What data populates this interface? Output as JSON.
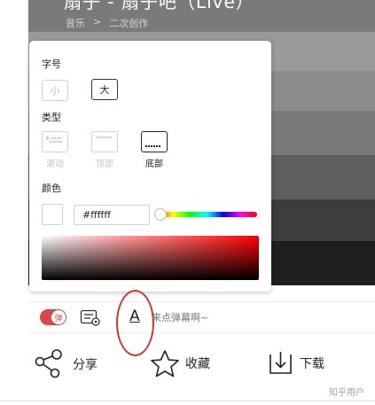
{
  "video": {
    "title": "扇子 - 扇子吧（Live）",
    "breadcrumb": [
      "音乐",
      ">",
      "二次创作"
    ]
  },
  "danmaku_settings": {
    "font_size": {
      "label": "字号",
      "options": [
        {
          "label": "小",
          "selected": false
        },
        {
          "label": "大",
          "selected": true
        }
      ]
    },
    "type": {
      "label": "类型",
      "options": [
        {
          "label": "滚动",
          "icon": "scroll-danmaku-icon",
          "selected": false
        },
        {
          "label": "顶部",
          "icon": "top-danmaku-icon",
          "selected": false
        },
        {
          "label": "底部",
          "icon": "bottom-danmaku-icon",
          "selected": true
        }
      ]
    },
    "color": {
      "label": "颜色",
      "value": "#ffffff",
      "hue_position": 0.0
    }
  },
  "toolbar": {
    "danmaku_toggle_label": "弹",
    "danmaku_enabled": true,
    "input_placeholder": "来点弹幕啊~"
  },
  "actions": [
    {
      "label": "分享",
      "icon": "share-icon"
    },
    {
      "label": "收藏",
      "icon": "star-icon"
    },
    {
      "label": "下载",
      "icon": "download-icon"
    }
  ],
  "watermark": "知乎用户",
  "colors": {
    "accent": "#d8484b",
    "annotation": "#c83a3a"
  }
}
